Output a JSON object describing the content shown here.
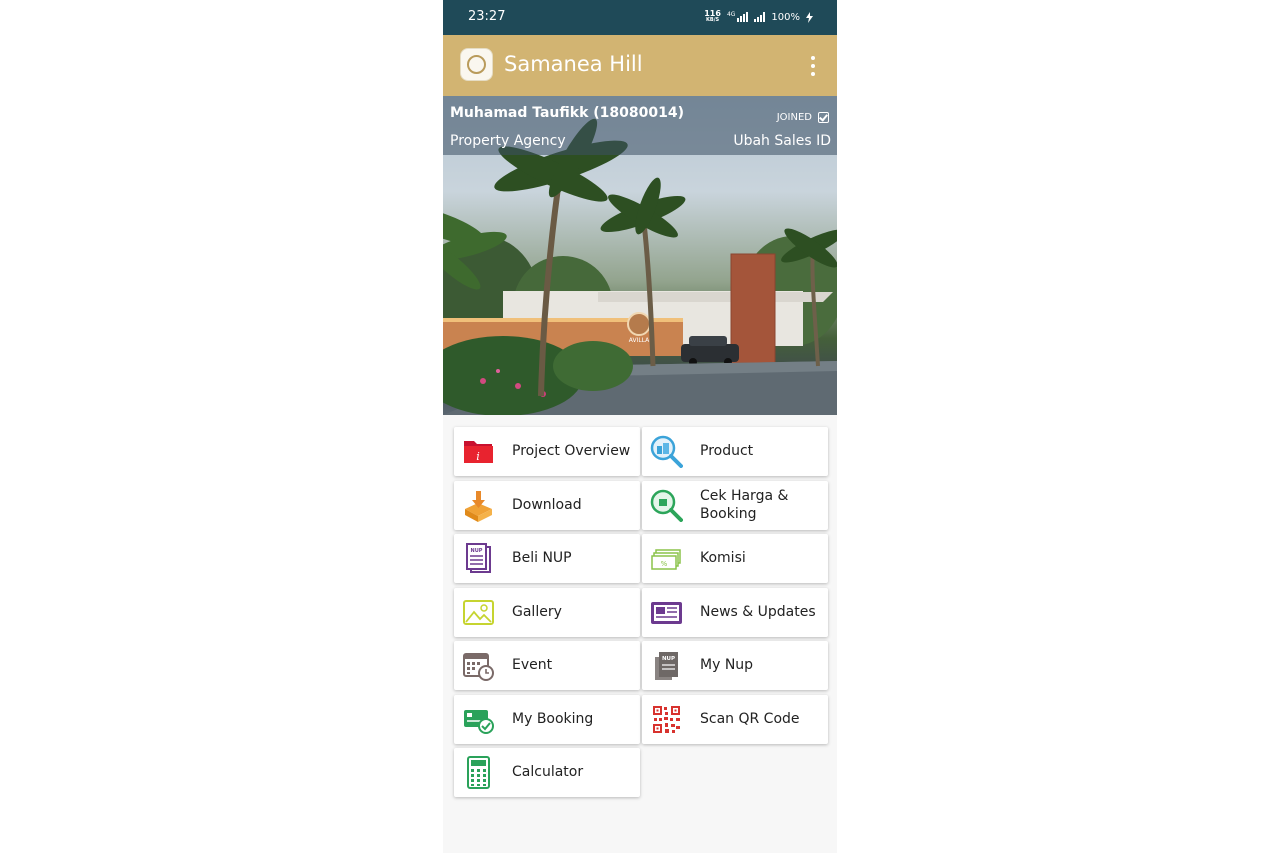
{
  "status_bar": {
    "time": "23:27",
    "speed_value": "116",
    "speed_unit": "KB/S",
    "net_label": "4G",
    "battery": "100%"
  },
  "app_bar": {
    "title": "Samanea Hill",
    "logo_icon": "samanea-logo",
    "menu_icon": "more-vert-icon"
  },
  "profile": {
    "name": "Muhamad Taufikk (18080014)",
    "agency": "Property Agency",
    "joined_label": "JOINED",
    "change_id_label": "Ubah Sales ID"
  },
  "hero": {
    "sign_text": "AVILLA"
  },
  "menu": [
    {
      "label": "Project Overview",
      "icon": "folder-info-icon"
    },
    {
      "label": "Product",
      "icon": "building-search-icon"
    },
    {
      "label": "Download",
      "icon": "download-tray-icon"
    },
    {
      "label": "Cek Harga & Booking",
      "icon": "price-search-icon"
    },
    {
      "label": "Beli NUP",
      "icon": "nup-document-icon"
    },
    {
      "label": "Komisi",
      "icon": "money-percent-icon"
    },
    {
      "label": "Gallery",
      "icon": "image-icon"
    },
    {
      "label": "News & Updates",
      "icon": "newspaper-icon"
    },
    {
      "label": "Event",
      "icon": "calendar-clock-icon"
    },
    {
      "label": "My Nup",
      "icon": "nup-stack-icon"
    },
    {
      "label": "My Booking",
      "icon": "booking-card-icon"
    },
    {
      "label": "Scan QR Code",
      "icon": "qr-code-icon"
    },
    {
      "label": "Calculator",
      "icon": "calculator-icon"
    }
  ],
  "colors": {
    "status_bar": "#1f4a58",
    "app_bar": "#d2b472",
    "background": "#f7f7f7"
  }
}
